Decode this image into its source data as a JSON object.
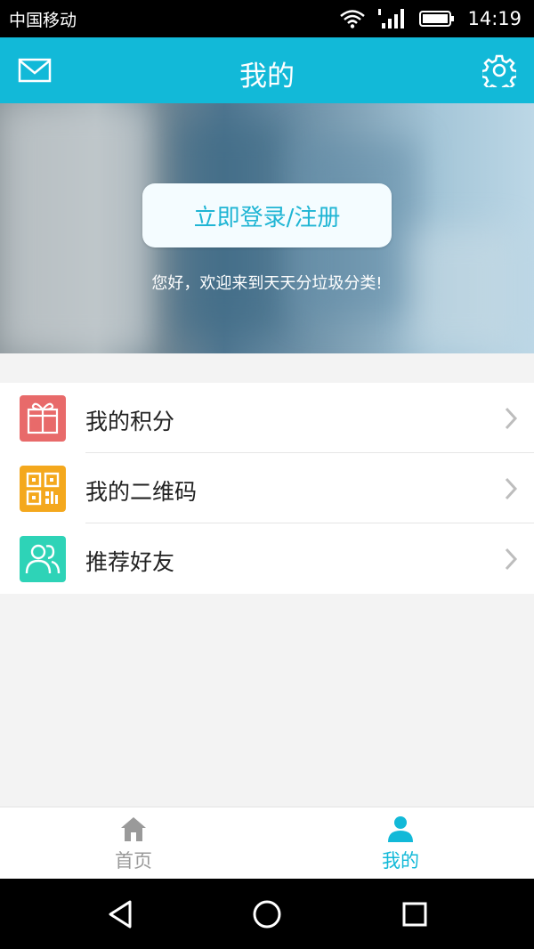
{
  "status_bar": {
    "carrier": "中国移动",
    "time": "14:19",
    "icons": [
      "wifi-icon",
      "signal-icon",
      "battery-icon"
    ]
  },
  "header": {
    "title": "我的",
    "left_icon": "mail-icon",
    "right_icon": "gear-icon"
  },
  "hero": {
    "login_button": "立即登录/注册",
    "welcome": "您好，欢迎来到天天分垃圾分类!"
  },
  "menu": {
    "items": [
      {
        "label": "我的积分",
        "icon": "gift-icon",
        "icon_color": "#e86a6a"
      },
      {
        "label": "我的二维码",
        "icon": "qr-code-icon",
        "icon_color": "#f4a81d"
      },
      {
        "label": "推荐好友",
        "icon": "friends-icon",
        "icon_color": "#2ed3b7"
      }
    ]
  },
  "tabs": [
    {
      "label": "首页",
      "icon": "home-icon",
      "active": false
    },
    {
      "label": "我的",
      "icon": "person-icon",
      "active": true
    }
  ],
  "colors": {
    "accent": "#12b9d8",
    "inactive_tab": "#9a9a9a",
    "background": "#f3f3f3"
  },
  "system_nav": [
    "back-icon",
    "home-circle-icon",
    "recents-icon"
  ]
}
